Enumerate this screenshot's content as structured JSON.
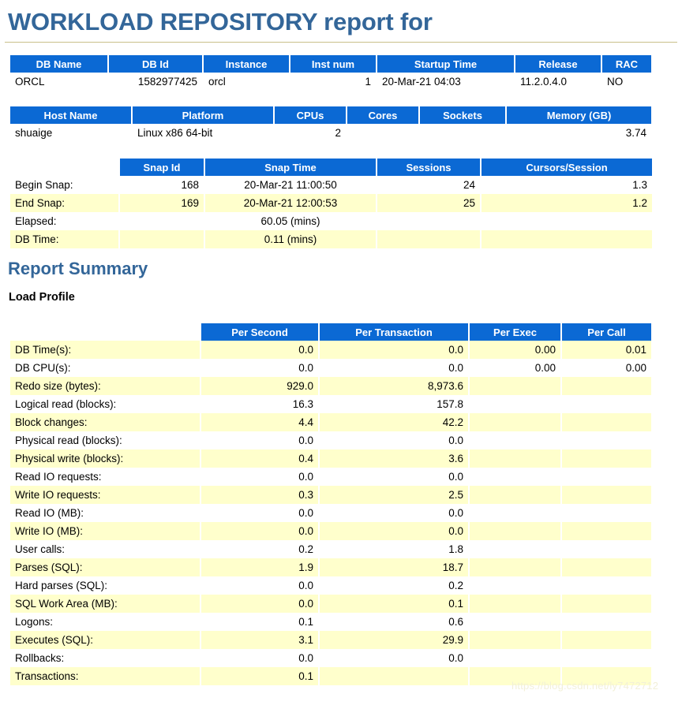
{
  "report": {
    "title": "WORKLOAD REPOSITORY report for",
    "summary_heading": "Report Summary",
    "load_profile_heading": "Load Profile",
    "watermark": "https://blog.csdn.net/ly7472712",
    "colors": {
      "header_blue": "#0b69d4",
      "title_blue": "#336699",
      "band_yellow": "#ffffcc",
      "rule_tan": "#c9c08a"
    }
  },
  "db_info": {
    "columns": [
      "DB Name",
      "DB Id",
      "Instance",
      "Inst num",
      "Startup Time",
      "Release",
      "RAC"
    ],
    "rows": [
      {
        "db_name": "ORCL",
        "db_id": "1582977425",
        "instance": "orcl",
        "inst_num": "1",
        "startup_time": "20-Mar-21 04:03",
        "release": "11.2.0.4.0",
        "rac": "NO"
      }
    ]
  },
  "host_info": {
    "columns": [
      "Host Name",
      "Platform",
      "CPUs",
      "Cores",
      "Sockets",
      "Memory (GB)"
    ],
    "rows": [
      {
        "host_name": "shuaige",
        "platform": "Linux x86 64-bit",
        "cpus": "2",
        "cores": "",
        "sockets": "",
        "memory_gb": "3.74"
      }
    ]
  },
  "snapshot_info": {
    "columns": [
      "",
      "Snap Id",
      "Snap Time",
      "Sessions",
      "Cursors/Session"
    ],
    "rows": [
      {
        "label": "Begin Snap:",
        "snap_id": "168",
        "snap_time": "20-Mar-21 11:00:50",
        "sessions": "24",
        "cursors_session": "1.3"
      },
      {
        "label": "End Snap:",
        "snap_id": "169",
        "snap_time": "20-Mar-21 12:00:53",
        "sessions": "25",
        "cursors_session": "1.2"
      },
      {
        "label": "Elapsed:",
        "snap_id": "",
        "snap_time": "60.05 (mins)",
        "sessions": "",
        "cursors_session": ""
      },
      {
        "label": "DB Time:",
        "snap_id": "",
        "snap_time": "0.11 (mins)",
        "sessions": "",
        "cursors_session": ""
      }
    ]
  },
  "load_profile": {
    "columns": [
      "",
      "Per Second",
      "Per Transaction",
      "Per Exec",
      "Per Call"
    ],
    "rows": [
      {
        "metric": "DB Time(s):",
        "per_second": "0.0",
        "per_transaction": "0.0",
        "per_exec": "0.00",
        "per_call": "0.01"
      },
      {
        "metric": "DB CPU(s):",
        "per_second": "0.0",
        "per_transaction": "0.0",
        "per_exec": "0.00",
        "per_call": "0.00"
      },
      {
        "metric": "Redo size (bytes):",
        "per_second": "929.0",
        "per_transaction": "8,973.6",
        "per_exec": "",
        "per_call": ""
      },
      {
        "metric": "Logical read (blocks):",
        "per_second": "16.3",
        "per_transaction": "157.8",
        "per_exec": "",
        "per_call": ""
      },
      {
        "metric": "Block changes:",
        "per_second": "4.4",
        "per_transaction": "42.2",
        "per_exec": "",
        "per_call": ""
      },
      {
        "metric": "Physical read (blocks):",
        "per_second": "0.0",
        "per_transaction": "0.0",
        "per_exec": "",
        "per_call": ""
      },
      {
        "metric": "Physical write (blocks):",
        "per_second": "0.4",
        "per_transaction": "3.6",
        "per_exec": "",
        "per_call": ""
      },
      {
        "metric": "Read IO requests:",
        "per_second": "0.0",
        "per_transaction": "0.0",
        "per_exec": "",
        "per_call": ""
      },
      {
        "metric": "Write IO requests:",
        "per_second": "0.3",
        "per_transaction": "2.5",
        "per_exec": "",
        "per_call": ""
      },
      {
        "metric": "Read IO (MB):",
        "per_second": "0.0",
        "per_transaction": "0.0",
        "per_exec": "",
        "per_call": ""
      },
      {
        "metric": "Write IO (MB):",
        "per_second": "0.0",
        "per_transaction": "0.0",
        "per_exec": "",
        "per_call": ""
      },
      {
        "metric": "User calls:",
        "per_second": "0.2",
        "per_transaction": "1.8",
        "per_exec": "",
        "per_call": ""
      },
      {
        "metric": "Parses (SQL):",
        "per_second": "1.9",
        "per_transaction": "18.7",
        "per_exec": "",
        "per_call": ""
      },
      {
        "metric": "Hard parses (SQL):",
        "per_second": "0.0",
        "per_transaction": "0.2",
        "per_exec": "",
        "per_call": ""
      },
      {
        "metric": "SQL Work Area (MB):",
        "per_second": "0.0",
        "per_transaction": "0.1",
        "per_exec": "",
        "per_call": ""
      },
      {
        "metric": "Logons:",
        "per_second": "0.1",
        "per_transaction": "0.6",
        "per_exec": "",
        "per_call": ""
      },
      {
        "metric": "Executes (SQL):",
        "per_second": "3.1",
        "per_transaction": "29.9",
        "per_exec": "",
        "per_call": ""
      },
      {
        "metric": "Rollbacks:",
        "per_second": "0.0",
        "per_transaction": "0.0",
        "per_exec": "",
        "per_call": ""
      },
      {
        "metric": "Transactions:",
        "per_second": "0.1",
        "per_transaction": "",
        "per_exec": "",
        "per_call": ""
      }
    ]
  }
}
